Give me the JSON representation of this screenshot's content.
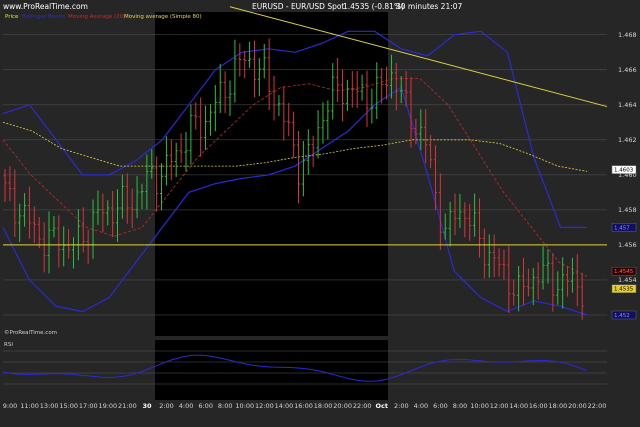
{
  "header": {
    "site": "www.ProRealTime.com",
    "title": "EURUSD - EUR/USD Spot",
    "last": "1.4535 (-0.81%)",
    "timeframe": "30 minutes 21:07"
  },
  "legend": [
    {
      "text": "Price",
      "color": "#e8e830"
    },
    {
      "text": "Bollinger Bands",
      "color": "#2a2ad8"
    },
    {
      "text": "Moving Average (20)",
      "color": "#d02828"
    },
    {
      "text": "Moving average (Simple 80)",
      "color": "#e8d850"
    }
  ],
  "watermark": "©ProRealTime.com",
  "sub_label": "RSI",
  "colors": {
    "background": "#262626",
    "night": "#000000",
    "grid": "#555555",
    "up": "#26c43a",
    "down": "#d8343c",
    "bands": "#2a2ad8",
    "ma20": "#c42a2a",
    "ma80": "#e0d23c",
    "lines": "#e0d23c"
  },
  "chart_data": {
    "type": "candlestick",
    "title": "EURUSD - EUR/USD Spot",
    "instrument": "EURUSD",
    "timeframe": "30 minutes",
    "last_price": 1.4535,
    "change_pct": -0.81,
    "y_ticks": [
      1.452,
      1.454,
      1.456,
      1.458,
      1.46,
      1.462,
      1.464,
      1.466,
      1.468
    ],
    "ylim": [
      1.4508,
      1.4693
    ],
    "x_ticks": [
      "9:00",
      "11:00",
      "13:00",
      "15:00",
      "17:00",
      "19:00",
      "21:00",
      "30",
      "2:00",
      "4:00",
      "6:00",
      "8:00",
      "10:00",
      "12:00",
      "14:00",
      "16:00",
      "18:00",
      "20:00",
      "22:00",
      "Oct",
      "2:00",
      "4:00",
      "6:00",
      "8:00",
      "10:00",
      "12:00",
      "14:00",
      "16:00",
      "18:00",
      "20:00",
      "22:00"
    ],
    "bold_ticks": [
      "30",
      "Oct"
    ],
    "price_tags": [
      {
        "text": "1.4603",
        "value": 1.4603,
        "bg": "#ffffff",
        "fg": "#000000"
      },
      {
        "text": "1.457",
        "value": 1.457,
        "bg": "#101060",
        "fg": "#8888ff"
      },
      {
        "text": "1.4545",
        "value": 1.4545,
        "bg": "#300000",
        "fg": "#ff6060"
      },
      {
        "text": "1.4535",
        "value": 1.4535,
        "bg": "#e8d020",
        "fg": "#000000"
      },
      {
        "text": "1.452",
        "value": 1.452,
        "bg": "#101060",
        "fg": "#8888ff"
      }
    ],
    "horizontal_line": 1.456,
    "trendline": {
      "from": 1.4696,
      "to": 1.4639
    },
    "candle_close_anchors": [
      [
        1.459,
        1.4582,
        1.4575,
        1.4568,
        1.456,
        1.4565,
        1.4558,
        1.4562,
        1.457,
        1.4578,
        1.458,
        1.4582,
        1.4585,
        1.4592,
        1.46,
        1.46
      ],
      [
        1.461,
        1.4618,
        1.4628,
        1.463,
        1.464,
        1.465,
        1.466,
        1.4668,
        1.466,
        1.4655,
        1.464,
        1.4625,
        1.4605,
        1.461,
        1.463,
        1.4645,
        1.465,
        1.4648,
        1.4645,
        1.4645,
        1.465,
        1.466
      ],
      [
        1.464,
        1.463,
        1.462,
        1.459,
        1.4565,
        1.458,
        1.4578,
        1.4565,
        1.4555,
        1.4548,
        1.454,
        1.4532,
        1.454,
        1.4545,
        1.454,
        1.4538,
        1.454,
        1.4535
      ]
    ],
    "bollinger_upper": [
      1.4635,
      1.464,
      1.462,
      1.46,
      1.46,
      1.4608,
      1.462,
      1.464,
      1.466,
      1.467,
      1.4672,
      1.467,
      1.4675,
      1.4682,
      1.4682,
      1.4672,
      1.4668,
      1.468,
      1.4682,
      1.467,
      1.461,
      1.457,
      1.457
    ],
    "bollinger_lower": [
      1.457,
      1.454,
      1.4525,
      1.4522,
      1.453,
      1.455,
      1.457,
      1.459,
      1.4595,
      1.4598,
      1.46,
      1.4605,
      1.4615,
      1.4625,
      1.464,
      1.465,
      1.46,
      1.4545,
      1.453,
      1.4522,
      1.4528,
      1.4525,
      1.452
    ],
    "ma80": [
      1.463,
      1.4625,
      1.4615,
      1.461,
      1.4605,
      1.4605,
      1.4605,
      1.4605,
      1.4605,
      1.4607,
      1.461,
      1.4612,
      1.4615,
      1.4617,
      1.462,
      1.462,
      1.462,
      1.4618,
      1.4612,
      1.4605,
      1.4602
    ],
    "ma20": [
      1.462,
      1.46,
      1.4585,
      1.457,
      1.4565,
      1.457,
      1.459,
      1.461,
      1.4625,
      1.464,
      1.465,
      1.4652,
      1.4648,
      1.465,
      1.4655,
      1.4655,
      1.464,
      1.4615,
      1.459,
      1.457,
      1.455,
      1.4542
    ]
  }
}
